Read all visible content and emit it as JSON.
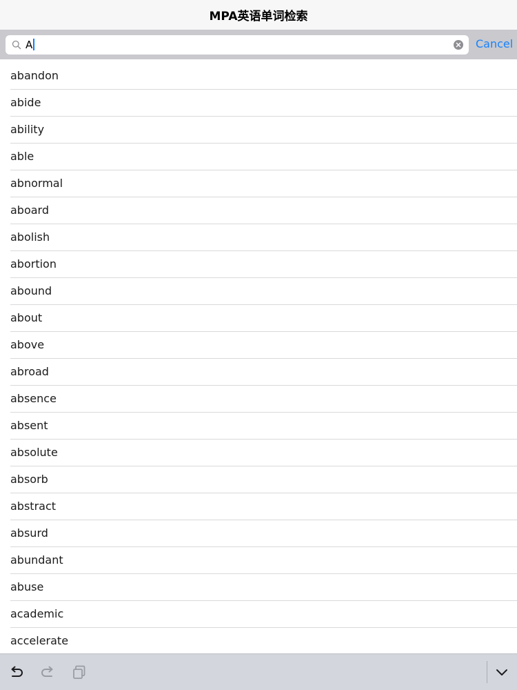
{
  "header": {
    "title": "MPA英语单词检索"
  },
  "search": {
    "value": "A",
    "cancel_label": "Cancel",
    "icon": "search-icon",
    "clear_icon": "clear-icon"
  },
  "words": [
    "abandon",
    "abide",
    "ability",
    "able",
    "abnormal",
    "aboard",
    "abolish",
    "abortion",
    "abound",
    "about",
    "above",
    "abroad",
    "absence",
    "absent",
    "absolute",
    "absorb",
    "abstract",
    "absurd",
    "abundant",
    "abuse",
    "academic",
    "accelerate"
  ],
  "toolbar": {
    "undo_icon": "undo-icon",
    "redo_icon": "redo-icon",
    "paste_icon": "paste-icon",
    "dismiss_icon": "chevron-down-icon"
  },
  "colors": {
    "accent": "#1a82fb",
    "search_bar_bg": "#c9c9ce",
    "toolbar_bg": "#d3d6dd"
  }
}
